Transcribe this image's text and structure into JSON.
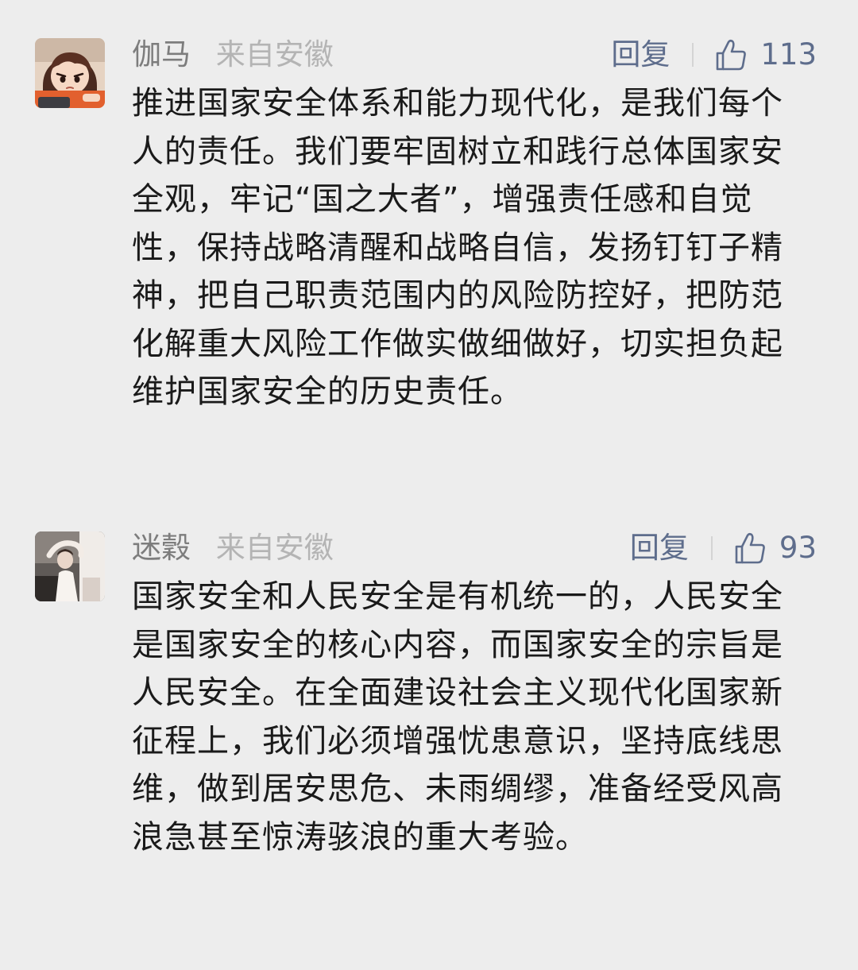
{
  "comments": [
    {
      "username": "伽马",
      "location": "来自安徽",
      "reply_label": "回复",
      "like_icon": "thumbs-up-icon",
      "like_count": "113",
      "content": "推进国家安全体系和能力现代化，是我们每个人的责任。我们要牢固树立和践行总体国家安全观，牢记“国之大者”，增强责任感和自觉性，保持战略清醒和战略自信，发扬钉钉子精神，把自己职责范围内的风险防控好，把防范化解重大风险工作做实做细做好，切实担负起维护国家安全的历史责任。"
    },
    {
      "username": "迷穀",
      "location": "来自安徽",
      "reply_label": "回复",
      "like_icon": "thumbs-up-icon",
      "like_count": "93",
      "content": "国家安全和人民安全是有机统一的，人民安全是国家安全的核心内容，而国家安全的宗旨是人民安全。在全面建设社会主义现代化国家新征程上，我们必须增强忧患意识，坚持底线思维，做到居安思危、未雨绸缪，准备经受风高浪急甚至惊涛骇浪的重大考验。"
    }
  ],
  "colors": {
    "background": "#ededed",
    "username": "#7d7d7d",
    "location": "#b4b4b4",
    "action_link": "#5e6d8c",
    "body_text": "#1a1a1a"
  }
}
